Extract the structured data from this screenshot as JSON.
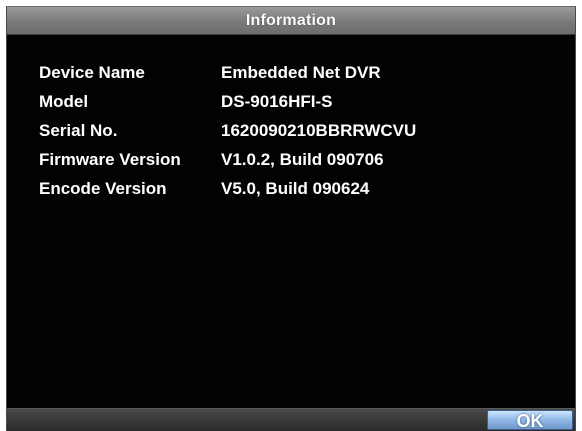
{
  "dialog": {
    "title": "Information",
    "rows": [
      {
        "label": "Device Name",
        "value": "Embedded Net DVR"
      },
      {
        "label": "Model",
        "value": "DS-9016HFI-S"
      },
      {
        "label": "Serial No.",
        "value": "1620090210BBRRWCVU"
      },
      {
        "label": "Firmware Version",
        "value": "V1.0.2, Build 090706"
      },
      {
        "label": "Encode Version",
        "value": "V5.0, Build 090624"
      }
    ],
    "ok_label": "OK"
  },
  "colors": {
    "background": "#020202",
    "text": "#ffffff",
    "titlebar": "#808080",
    "button_accent": "#8fb8e6"
  }
}
